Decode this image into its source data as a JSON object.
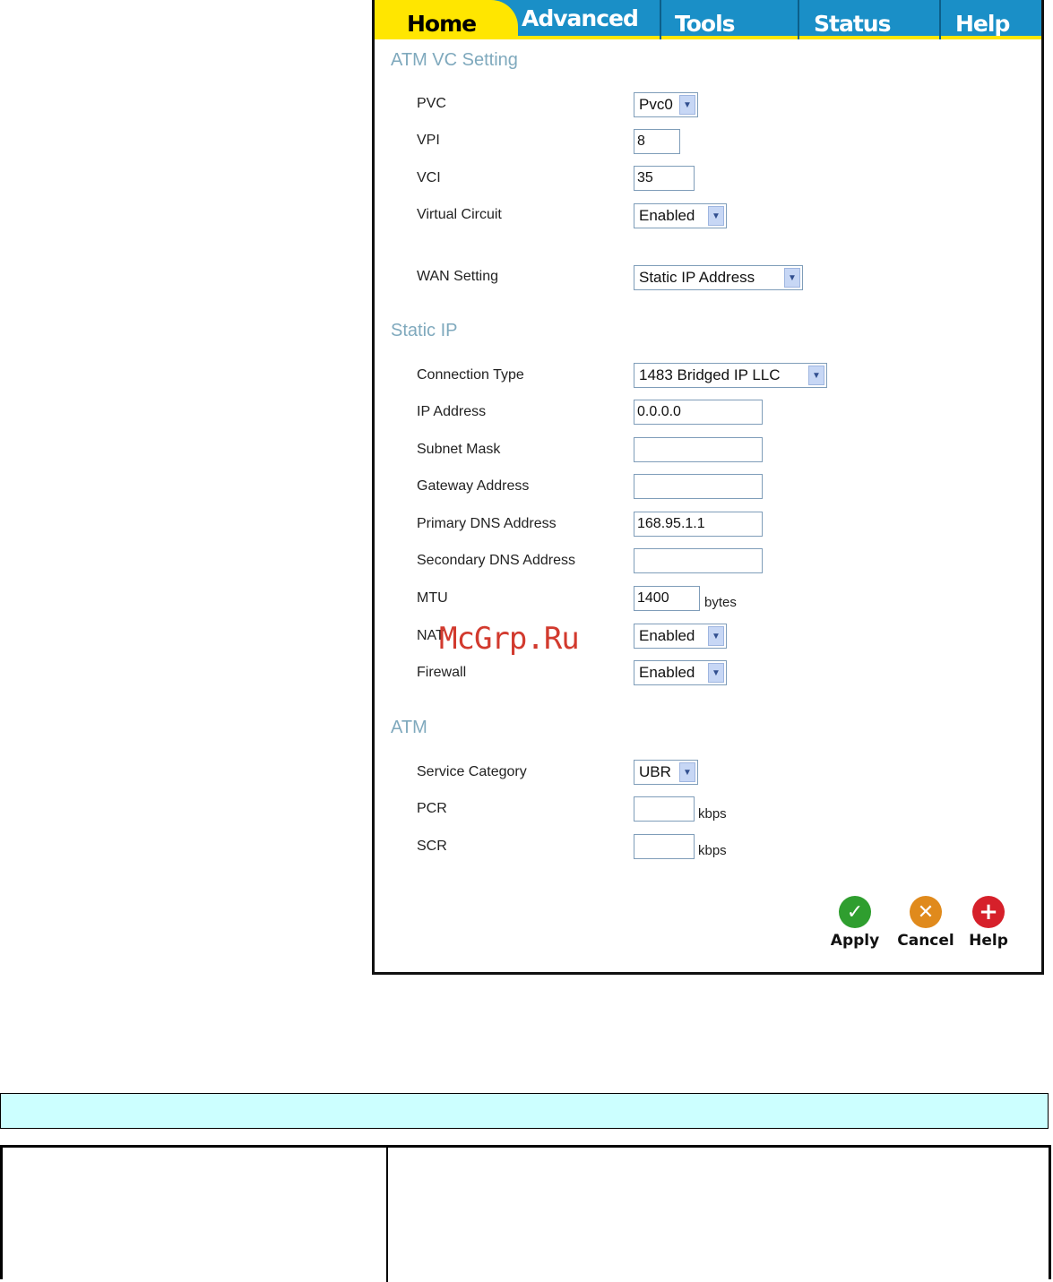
{
  "tabs": [
    "Home",
    "Advanced",
    "Tools",
    "Status",
    "Help"
  ],
  "sections": {
    "atm_vc": "ATM VC Setting",
    "static_ip": "Static IP",
    "atm": "ATM"
  },
  "fields": {
    "pvc": {
      "label": "PVC",
      "value": "Pvc0"
    },
    "vpi": {
      "label": "VPI",
      "value": "8"
    },
    "vci": {
      "label": "VCI",
      "value": "35"
    },
    "virtual_circuit": {
      "label": "Virtual Circuit",
      "value": "Enabled"
    },
    "wan_setting": {
      "label": "WAN Setting",
      "value": "Static IP Address"
    },
    "connection_type": {
      "label": "Connection Type",
      "value": "1483 Bridged IP LLC"
    },
    "ip_address": {
      "label": "IP Address",
      "value": "0.0.0.0"
    },
    "subnet_mask": {
      "label": "Subnet Mask",
      "value": ""
    },
    "gateway_address": {
      "label": "Gateway Address",
      "value": ""
    },
    "primary_dns": {
      "label": "Primary DNS Address",
      "value": "168.95.1.1"
    },
    "secondary_dns": {
      "label": "Secondary DNS Address",
      "value": ""
    },
    "mtu": {
      "label": "MTU",
      "value": "1400",
      "unit": "bytes"
    },
    "nat": {
      "label": "NAT",
      "value": "Enabled"
    },
    "firewall": {
      "label": "Firewall",
      "value": "Enabled"
    },
    "service_category": {
      "label": "Service Category",
      "value": "UBR"
    },
    "pcr": {
      "label": "PCR",
      "value": "",
      "unit": "kbps"
    },
    "scr": {
      "label": "SCR",
      "value": "",
      "unit": "kbps"
    }
  },
  "buttons": {
    "apply": "Apply",
    "cancel": "Cancel",
    "help": "Help"
  },
  "watermark": "McGrp.Ru",
  "colors": {
    "tab_bg": "#1a8fc7",
    "tab_active": "#ffe600",
    "section_title": "#7fa9bd",
    "apply": "#2f9e2f",
    "cancel": "#e08a1c",
    "help": "#d6202a",
    "info_bar": "#ccffff"
  }
}
